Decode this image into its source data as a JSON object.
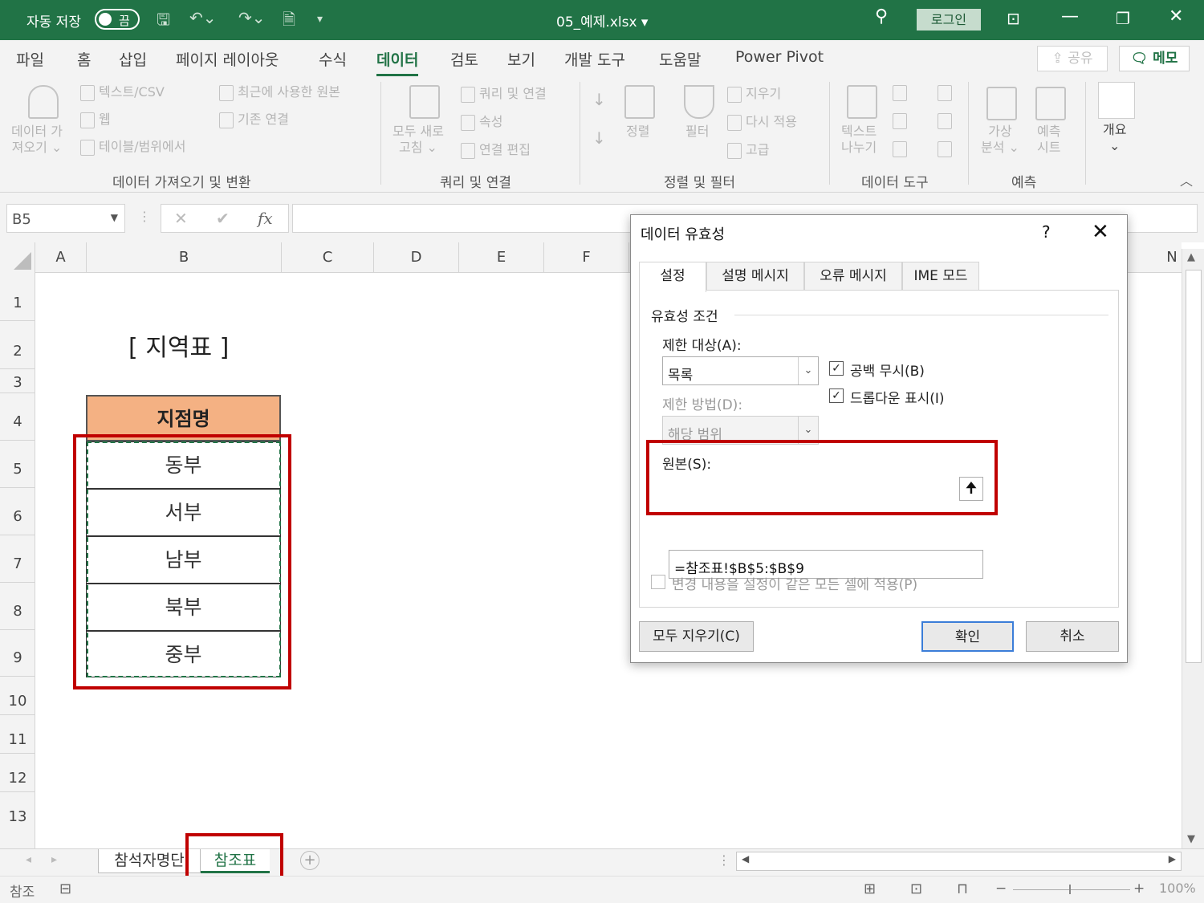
{
  "titlebar": {
    "autosave_label": "자동 저장",
    "autosave_state": "끔",
    "filename": "05_예제.xlsx",
    "login_label": "로그인"
  },
  "ribbon_tabs": [
    {
      "label": "파일"
    },
    {
      "label": "홈"
    },
    {
      "label": "삽입"
    },
    {
      "label": "페이지 레이아웃"
    },
    {
      "label": "수식"
    },
    {
      "label": "데이터"
    },
    {
      "label": "검토"
    },
    {
      "label": "보기"
    },
    {
      "label": "개발 도구"
    },
    {
      "label": "도움말"
    },
    {
      "label": "Power Pivot"
    }
  ],
  "active_tab": "데이터",
  "share_label": "공유",
  "memo_label": "메모",
  "ribbon": {
    "get_data_line1": "데이터 가",
    "get_data_line2": "져오기",
    "text_csv": "텍스트/CSV",
    "web": "웹",
    "table_range": "테이블/범위에서",
    "recent_sources": "최근에 사용한 원본",
    "existing_connections": "기존 연결",
    "group_get_transform": "데이터 가져오기 및 변환",
    "refresh_line1": "모두 새로",
    "refresh_line2": "고침",
    "queries_connections": "쿼리 및 연결",
    "properties": "속성",
    "edit_links": "연결 편집",
    "group_queries": "쿼리 및 연결",
    "sort": "정렬",
    "filter": "필터",
    "clear": "지우기",
    "reapply": "다시 적용",
    "advanced": "고급",
    "group_sort_filter": "정렬 및 필터",
    "text_to_columns_line1": "텍스트",
    "text_to_columns_line2": "나누기",
    "group_data_tools": "데이터 도구",
    "what_if_line1": "가상",
    "what_if_line2": "분석",
    "forecast_line1": "예측",
    "forecast_line2": "시트",
    "group_forecast": "예측",
    "outline": "개요"
  },
  "formula_bar": {
    "name_box": "B5",
    "fx": "fx",
    "formula": ""
  },
  "columns": [
    "A",
    "B",
    "C",
    "D",
    "E",
    "F",
    "N"
  ],
  "rows": [
    "1",
    "2",
    "3",
    "4",
    "5",
    "6",
    "7",
    "8",
    "9",
    "10",
    "11",
    "12",
    "13"
  ],
  "sheet": {
    "title": "[ 지역표 ]",
    "header": "지점명",
    "items": [
      "동부",
      "서부",
      "남부",
      "북부",
      "중부"
    ]
  },
  "sheet_tabs": [
    {
      "label": "참석자명단"
    },
    {
      "label": "참조표"
    }
  ],
  "status": {
    "mode": "참조",
    "zoom": "100%"
  },
  "dialog": {
    "title": "데이터 유효성",
    "help": "?",
    "tabs": [
      "설정",
      "설명 메시지",
      "오류 메시지",
      "IME 모드"
    ],
    "section": "유효성 조건",
    "allow_label": "제한 대상(A):",
    "allow_value": "목록",
    "data_label": "제한 방법(D):",
    "data_value": "해당 범위",
    "ignore_blank": "공백 무시(B)",
    "dropdown": "드롭다운 표시(I)",
    "source_label": "원본(S):",
    "source_value": "=참조표!$B$5:$B$9",
    "apply_all": "변경 내용을 설정이 같은 모든 셀에 적용(P)",
    "clear_all": "모두 지우기(C)",
    "ok": "확인",
    "cancel": "취소"
  }
}
